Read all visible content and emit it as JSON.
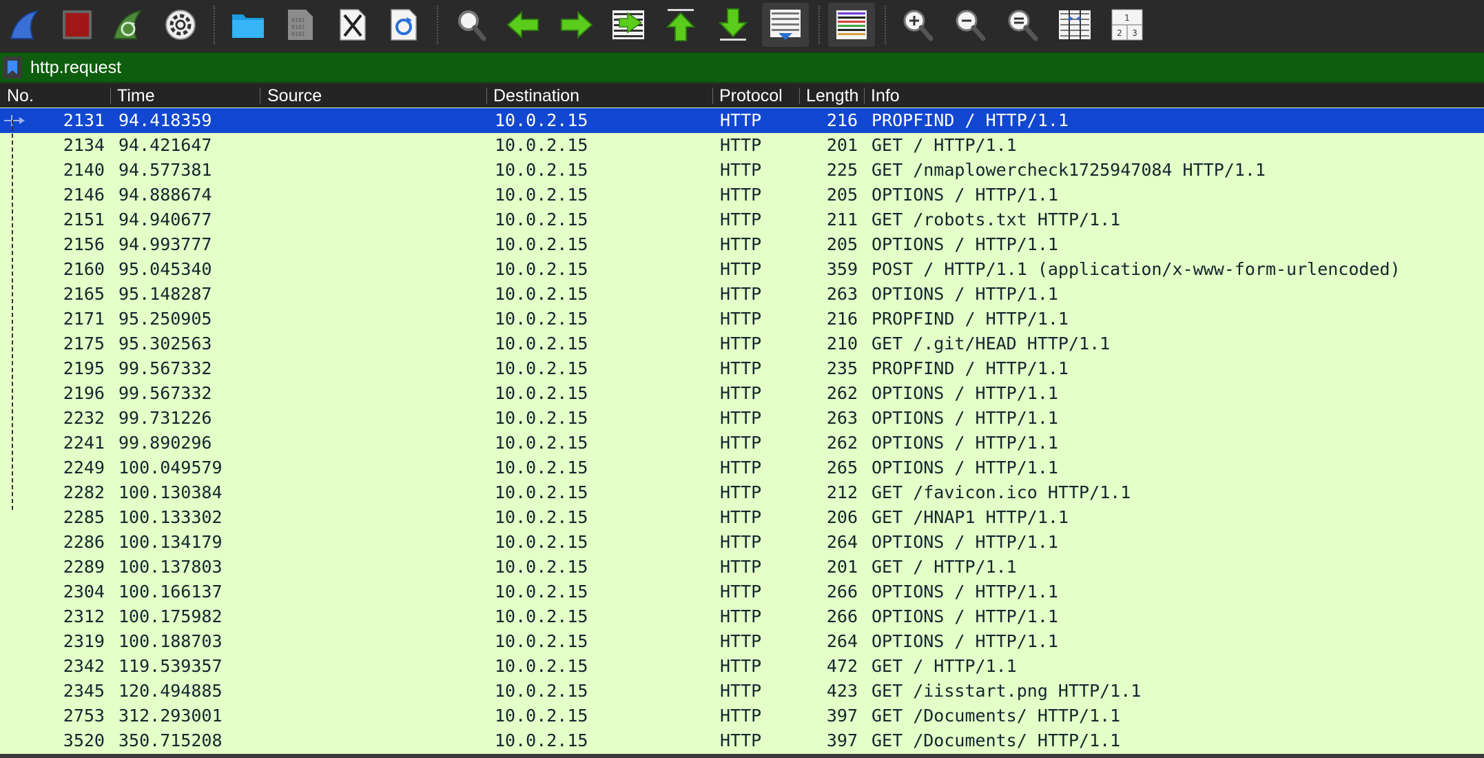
{
  "toolbar": {
    "buttons": [
      {
        "icon": "shark-fin-icon"
      },
      {
        "icon": "stop-capture-icon"
      },
      {
        "icon": "restart-capture-icon"
      },
      {
        "icon": "capture-options-icon"
      },
      {
        "icon": "open-folder-icon"
      },
      {
        "icon": "save-file-icon"
      },
      {
        "icon": "close-file-icon"
      },
      {
        "icon": "reload-file-icon"
      },
      {
        "icon": "find-packet-icon"
      },
      {
        "icon": "go-back-icon"
      },
      {
        "icon": "go-forward-icon"
      },
      {
        "icon": "go-to-packet-icon"
      },
      {
        "icon": "first-packet-icon"
      },
      {
        "icon": "last-packet-icon"
      },
      {
        "icon": "auto-scroll-icon"
      },
      {
        "icon": "colorize-icon"
      },
      {
        "icon": "zoom-in-icon"
      },
      {
        "icon": "zoom-out-icon"
      },
      {
        "icon": "normal-size-icon"
      },
      {
        "icon": "resize-columns-icon"
      },
      {
        "icon": "layout-panes-icon"
      }
    ],
    "layout_labels": [
      "1",
      "2",
      "3"
    ]
  },
  "filter": {
    "value": "http.request"
  },
  "columns": {
    "no": "No.",
    "time": "Time",
    "source": "Source",
    "destination": "Destination",
    "protocol": "Protocol",
    "length": "Length",
    "info": "Info"
  },
  "packets": [
    {
      "no": "2131",
      "time": "94.418359",
      "source": "",
      "destination": "10.0.2.15",
      "protocol": "HTTP",
      "length": "216",
      "info": "PROPFIND / HTTP/1.1"
    },
    {
      "no": "2134",
      "time": "94.421647",
      "source": "",
      "destination": "10.0.2.15",
      "protocol": "HTTP",
      "length": "201",
      "info": "GET / HTTP/1.1"
    },
    {
      "no": "2140",
      "time": "94.577381",
      "source": "",
      "destination": "10.0.2.15",
      "protocol": "HTTP",
      "length": "225",
      "info": "GET /nmaplowercheck1725947084 HTTP/1.1"
    },
    {
      "no": "2146",
      "time": "94.888674",
      "source": "",
      "destination": "10.0.2.15",
      "protocol": "HTTP",
      "length": "205",
      "info": "OPTIONS / HTTP/1.1"
    },
    {
      "no": "2151",
      "time": "94.940677",
      "source": "",
      "destination": "10.0.2.15",
      "protocol": "HTTP",
      "length": "211",
      "info": "GET /robots.txt HTTP/1.1"
    },
    {
      "no": "2156",
      "time": "94.993777",
      "source": "",
      "destination": "10.0.2.15",
      "protocol": "HTTP",
      "length": "205",
      "info": "OPTIONS / HTTP/1.1"
    },
    {
      "no": "2160",
      "time": "95.045340",
      "source": "",
      "destination": "10.0.2.15",
      "protocol": "HTTP",
      "length": "359",
      "info": "POST / HTTP/1.1  (application/x-www-form-urlencoded)"
    },
    {
      "no": "2165",
      "time": "95.148287",
      "source": "",
      "destination": "10.0.2.15",
      "protocol": "HTTP",
      "length": "263",
      "info": "OPTIONS / HTTP/1.1"
    },
    {
      "no": "2171",
      "time": "95.250905",
      "source": "",
      "destination": "10.0.2.15",
      "protocol": "HTTP",
      "length": "216",
      "info": "PROPFIND / HTTP/1.1"
    },
    {
      "no": "2175",
      "time": "95.302563",
      "source": "",
      "destination": "10.0.2.15",
      "protocol": "HTTP",
      "length": "210",
      "info": "GET /.git/HEAD HTTP/1.1"
    },
    {
      "no": "2195",
      "time": "99.567332",
      "source": "",
      "destination": "10.0.2.15",
      "protocol": "HTTP",
      "length": "235",
      "info": "PROPFIND / HTTP/1.1"
    },
    {
      "no": "2196",
      "time": "99.567332",
      "source": "",
      "destination": "10.0.2.15",
      "protocol": "HTTP",
      "length": "262",
      "info": "OPTIONS / HTTP/1.1"
    },
    {
      "no": "2232",
      "time": "99.731226",
      "source": "",
      "destination": "10.0.2.15",
      "protocol": "HTTP",
      "length": "263",
      "info": "OPTIONS / HTTP/1.1"
    },
    {
      "no": "2241",
      "time": "99.890296",
      "source": "",
      "destination": "10.0.2.15",
      "protocol": "HTTP",
      "length": "262",
      "info": "OPTIONS / HTTP/1.1"
    },
    {
      "no": "2249",
      "time": "100.049579",
      "source": "",
      "destination": "10.0.2.15",
      "protocol": "HTTP",
      "length": "265",
      "info": "OPTIONS / HTTP/1.1"
    },
    {
      "no": "2282",
      "time": "100.130384",
      "source": "",
      "destination": "10.0.2.15",
      "protocol": "HTTP",
      "length": "212",
      "info": "GET /favicon.ico HTTP/1.1"
    },
    {
      "no": "2285",
      "time": "100.133302",
      "source": "",
      "destination": "10.0.2.15",
      "protocol": "HTTP",
      "length": "206",
      "info": "GET /HNAP1 HTTP/1.1"
    },
    {
      "no": "2286",
      "time": "100.134179",
      "source": "",
      "destination": "10.0.2.15",
      "protocol": "HTTP",
      "length": "264",
      "info": "OPTIONS / HTTP/1.1"
    },
    {
      "no": "2289",
      "time": "100.137803",
      "source": "",
      "destination": "10.0.2.15",
      "protocol": "HTTP",
      "length": "201",
      "info": "GET / HTTP/1.1"
    },
    {
      "no": "2304",
      "time": "100.166137",
      "source": "",
      "destination": "10.0.2.15",
      "protocol": "HTTP",
      "length": "266",
      "info": "OPTIONS / HTTP/1.1"
    },
    {
      "no": "2312",
      "time": "100.175982",
      "source": "",
      "destination": "10.0.2.15",
      "protocol": "HTTP",
      "length": "266",
      "info": "OPTIONS / HTTP/1.1"
    },
    {
      "no": "2319",
      "time": "100.188703",
      "source": "",
      "destination": "10.0.2.15",
      "protocol": "HTTP",
      "length": "264",
      "info": "OPTIONS / HTTP/1.1"
    },
    {
      "no": "2342",
      "time": "119.539357",
      "source": "",
      "destination": "10.0.2.15",
      "protocol": "HTTP",
      "length": "472",
      "info": "GET / HTTP/1.1"
    },
    {
      "no": "2345",
      "time": "120.494885",
      "source": "",
      "destination": "10.0.2.15",
      "protocol": "HTTP",
      "length": "423",
      "info": "GET /iisstart.png HTTP/1.1"
    },
    {
      "no": "2753",
      "time": "312.293001",
      "source": "",
      "destination": "10.0.2.15",
      "protocol": "HTTP",
      "length": "397",
      "info": "GET /Documents/ HTTP/1.1"
    },
    {
      "no": "3520",
      "time": "350.715208",
      "source": "",
      "destination": "10.0.2.15",
      "protocol": "HTTP",
      "length": "397",
      "info": "GET /Documents/ HTTP/1.1"
    }
  ],
  "selected_packet": "2131",
  "colors": {
    "row_bg": "#e4ffc7",
    "row_text": "#12272e",
    "selected_bg": "#1147d1",
    "filter_valid_bg": "#0e5d0e"
  }
}
